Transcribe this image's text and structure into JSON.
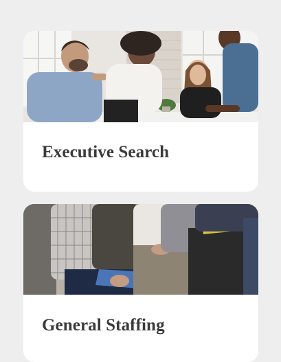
{
  "cards": [
    {
      "title": "Executive Search",
      "image": "team-meeting-photo"
    },
    {
      "title": "General Staffing",
      "image": "seated-candidates-photo"
    }
  ]
}
